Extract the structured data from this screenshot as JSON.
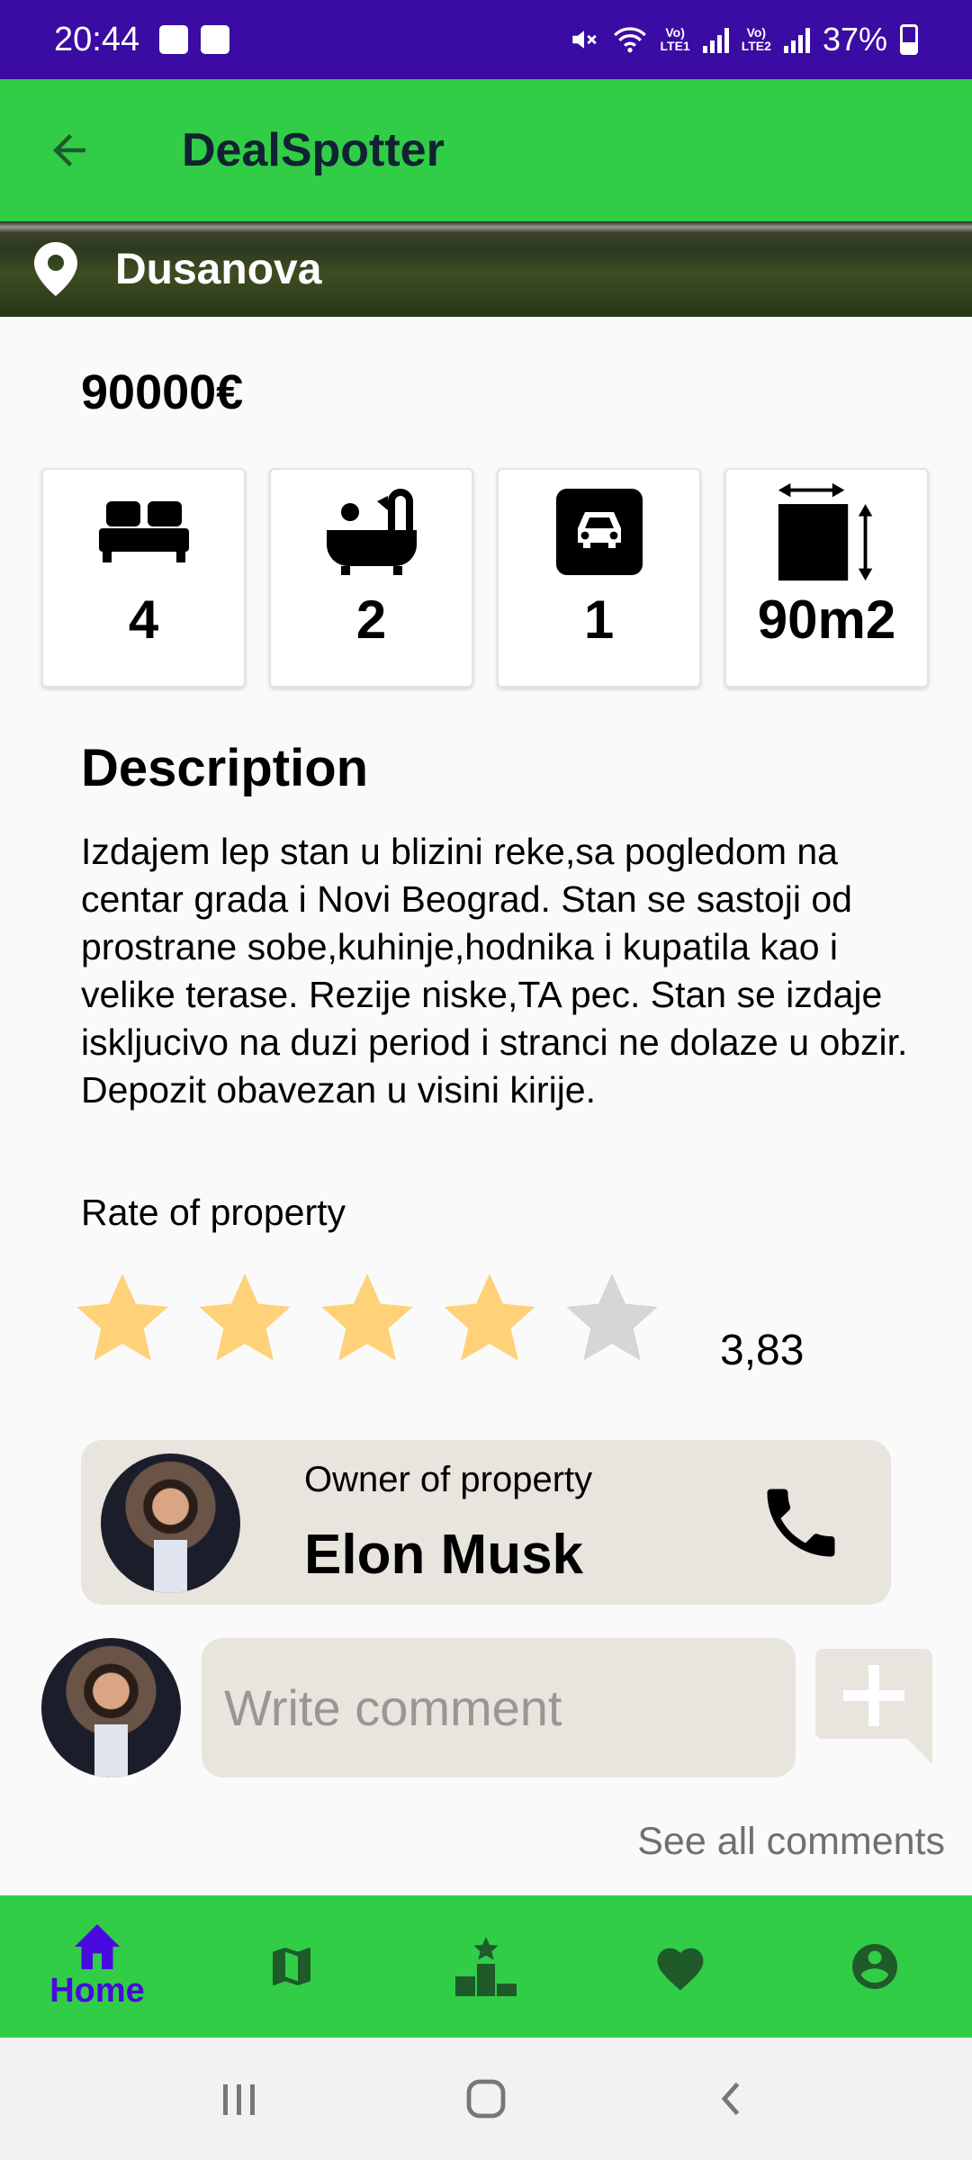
{
  "status_bar": {
    "time": "20:44",
    "battery": "37%",
    "lte1": "Vo) LTE1",
    "lte2": "Vo) LTE2"
  },
  "app_bar": {
    "title": "DealSpotter"
  },
  "banner": {
    "address": "Dusanova"
  },
  "listing": {
    "price": "90000€",
    "features": {
      "bedrooms": "4",
      "bathrooms": "2",
      "parking": "1",
      "area": "90m2"
    },
    "description_heading": "Description",
    "description": "Izdajem lep stan u blizini reke,sa pogledom na centar grada i Novi Beograd.  Stan se sastoji od prostrane sobe,kuhinje,hodnika i kupatila kao i velike terase.  Rezije niske,TA pec.  Stan se izdaje iskljucivo na duzi period i stranci ne dolaze u obzir.    Depozit obavezan u visini kirije.",
    "rate_label": "Rate of property",
    "stars_filled": 4,
    "stars_total": 5,
    "rating_value": "3,83"
  },
  "owner": {
    "label": "Owner of property",
    "name": "Elon Musk"
  },
  "comments": {
    "placeholder": "Write comment",
    "see_all": "See all comments"
  },
  "bottom_nav": {
    "home_label": "Home"
  },
  "colors": {
    "primary_green": "#31cd47",
    "status_purple": "#3a0ca3",
    "nav_active": "#4a0adf",
    "star_gold": "#ffd27a",
    "star_gray": "#d6d6d6"
  }
}
